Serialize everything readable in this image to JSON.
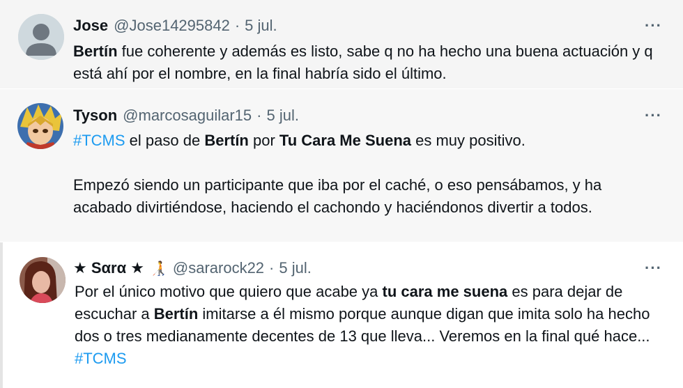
{
  "tweets": [
    {
      "name": "Jose",
      "handle": "@Jose14295842",
      "dot": "·",
      "date": "5 jul.",
      "more": "···",
      "body": {
        "b1": "Bertín",
        "t1": " fue coherente y además es listo, sabe q no ha hecho una buena actuación y q está ahí por el nombre, en la final habría sido el último."
      }
    },
    {
      "name": "Tyson",
      "handle": "@marcosaguilar15",
      "dot": "·",
      "date": "5 jul.",
      "more": "···",
      "body": {
        "tag": "#TCMS",
        "t1": " el paso de ",
        "b1": "Bertín",
        "t2": " por ",
        "b2": "Tu Cara Me Suena",
        "t3": " es muy positivo.",
        "p2": "Empezó siendo un participante que iba por el caché, o eso pensábamos, y ha acabado divirtiéndose, haciendo el cachondo y haciéndonos divertir a todos."
      }
    },
    {
      "name": "★ Sαrα ★",
      "name_emoji": "🧑‍🦯",
      "handle": "@sararock22",
      "dot": "·",
      "date": "5 jul.",
      "more": "···",
      "body": {
        "t1": "Por el único motivo que quiero que acabe ya ",
        "b1": "tu cara me suena",
        "t2": " es para dejar de escuchar a ",
        "b2": "Bertín",
        "t3": " imitarse a él mismo porque aunque digan que imita solo ha hecho dos o tres medianamente decentes de 13 que lleva... Veremos en la final qué hace...  ",
        "tag": "#TCMS"
      }
    }
  ],
  "colors": {
    "text": "#0f1419",
    "secondary": "#536471",
    "link": "#1d9bf0",
    "bg_tweet1": "#f5f5f5",
    "bg_tweet2": "#f7f7f7"
  },
  "icons": {
    "avatar1": "default-person-avatar",
    "avatar2": "anime-character-avatar",
    "avatar3": "photo-avatar"
  }
}
